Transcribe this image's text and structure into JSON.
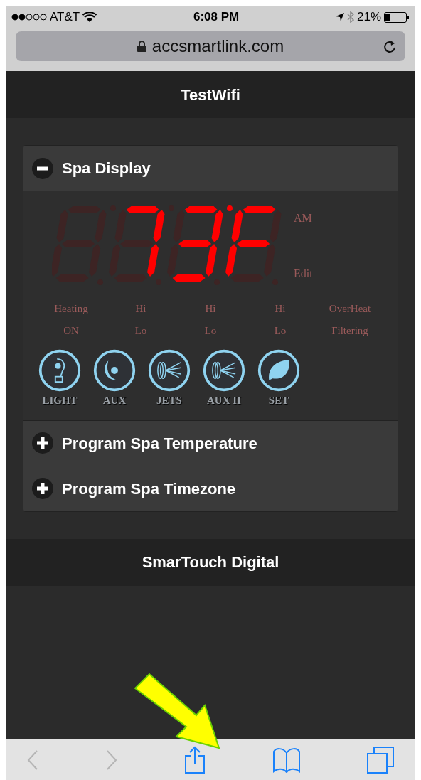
{
  "status_bar": {
    "carrier": "AT&T",
    "time": "6:08 PM",
    "battery": "21%"
  },
  "address_bar": {
    "url": "accsmartlink.com"
  },
  "header": {
    "title": "TestWifi"
  },
  "sections": [
    {
      "title": "Spa Display",
      "expanded": true
    },
    {
      "title": "Program Spa Temperature",
      "expanded": false
    },
    {
      "title": "Program Spa Timezone",
      "expanded": false
    }
  ],
  "display": {
    "digits": [
      {
        "segments_on": [
          false,
          false,
          false,
          false,
          false,
          false,
          false
        ]
      },
      {
        "segments_on": [
          true,
          true,
          true,
          false,
          false,
          false,
          false
        ]
      },
      {
        "segments_on": [
          true,
          true,
          true,
          true,
          false,
          false,
          true
        ]
      },
      {
        "segments_on": [
          true,
          false,
          false,
          false,
          true,
          true,
          true
        ]
      }
    ],
    "degree": true,
    "side_labels": [
      {
        "label": "AM",
        "lit": false
      },
      {
        "label": "Edit",
        "lit": false
      }
    ],
    "indicators": [
      {
        "top": "Heating",
        "bottom": "ON",
        "lit": false
      },
      {
        "top": "Hi",
        "bottom": "Lo",
        "lit": false
      },
      {
        "top": "Hi",
        "bottom": "Lo",
        "lit": false
      },
      {
        "top": "Hi",
        "bottom": "Lo",
        "lit": false
      },
      {
        "top": "OverHeat",
        "bottom": "Filtering",
        "lit": false
      }
    ]
  },
  "controls": [
    {
      "kind": "light",
      "label": "LIGHT"
    },
    {
      "kind": "aux",
      "label": "AUX"
    },
    {
      "kind": "jets",
      "label": "JETS"
    },
    {
      "kind": "jets",
      "label": "AUX II"
    },
    {
      "kind": "leaf",
      "label": "SET"
    }
  ],
  "footer": {
    "title": "SmarTouch Digital"
  },
  "toolbar": {
    "back_disabled": true,
    "forward_disabled": true
  }
}
